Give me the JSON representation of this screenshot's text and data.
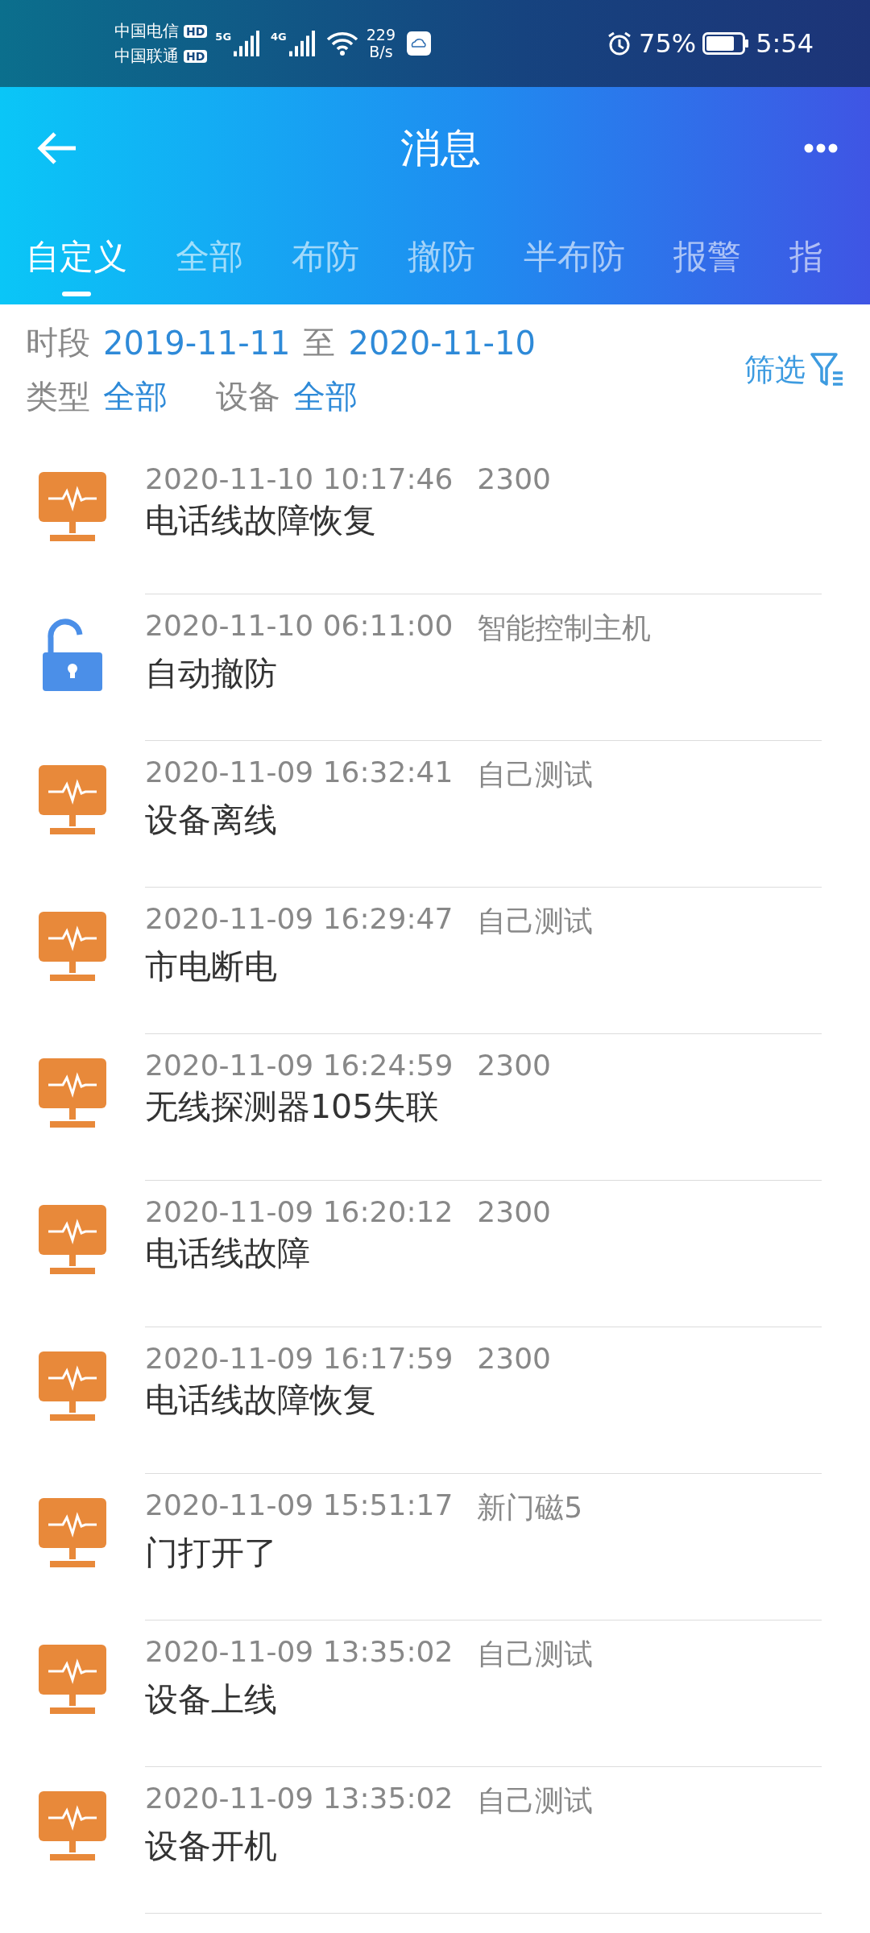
{
  "status_bar": {
    "carriers": [
      "中国电信",
      "中国联通"
    ],
    "hd_badges": [
      "HD",
      "HD"
    ],
    "signals": [
      "5G",
      "4G"
    ],
    "speed_value": "229",
    "speed_unit": "B/s",
    "battery": "75%",
    "time": "5:54"
  },
  "header": {
    "title": "消息"
  },
  "tabs": [
    {
      "label": "自定义",
      "selected": true
    },
    {
      "label": "全部",
      "selected": false
    },
    {
      "label": "布防",
      "selected": false
    },
    {
      "label": "撤防",
      "selected": false
    },
    {
      "label": "半布防",
      "selected": false
    },
    {
      "label": "报警",
      "selected": false
    },
    {
      "label": "指",
      "selected": false
    }
  ],
  "filter": {
    "period_label": "时段",
    "start": "2019-11-11",
    "to": "至",
    "end": "2020-11-10",
    "type_label": "类型",
    "type_value": "全部",
    "device_label": "设备",
    "device_value": "全部",
    "filter_button": "筛选"
  },
  "messages": [
    {
      "kind": "device",
      "time": "2020-11-10 10:17:46",
      "source": "2300",
      "text": "电话线故障恢复"
    },
    {
      "kind": "disarm",
      "time": "2020-11-10 06:11:00",
      "source": "智能控制主机",
      "text": "自动撤防"
    },
    {
      "kind": "device",
      "time": "2020-11-09 16:32:41",
      "source": "自己测试",
      "text": "设备离线"
    },
    {
      "kind": "device",
      "time": "2020-11-09 16:29:47",
      "source": "自己测试",
      "text": "市电断电"
    },
    {
      "kind": "device",
      "time": "2020-11-09 16:24:59",
      "source": "2300",
      "text": "无线探测器105失联"
    },
    {
      "kind": "device",
      "time": "2020-11-09 16:20:12",
      "source": "2300",
      "text": "电话线故障"
    },
    {
      "kind": "device",
      "time": "2020-11-09 16:17:59",
      "source": "2300",
      "text": "电话线故障恢复"
    },
    {
      "kind": "device",
      "time": "2020-11-09 15:51:17",
      "source": "新门磁5",
      "text": "门打开了"
    },
    {
      "kind": "device",
      "time": "2020-11-09 13:35:02",
      "source": "自己测试",
      "text": "设备上线"
    },
    {
      "kind": "device",
      "time": "2020-11-09 13:35:02",
      "source": "自己测试",
      "text": "设备开机"
    }
  ]
}
